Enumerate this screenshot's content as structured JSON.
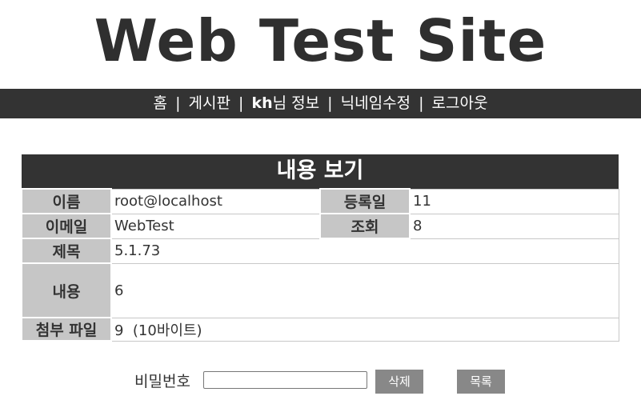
{
  "site": {
    "title": "Web Test Site"
  },
  "nav": {
    "home": "홈",
    "board": "게시판",
    "user_id": "kh",
    "user_info_suffix": "님 정보",
    "nickname_edit": "닉네임수정",
    "logout": "로그아웃",
    "separator": "|"
  },
  "post": {
    "caption": "내용 보기",
    "name_label": "이름",
    "name_value": "root@localhost",
    "date_label": "등록일",
    "date_value": "11",
    "email_label": "이메일",
    "email_value": "WebTest",
    "views_label": "조회",
    "views_value": "8",
    "subject_label": "제목",
    "subject_value": "5.1.73",
    "content_label": "내용",
    "content_value": "6",
    "file_label": "첨부 파일",
    "file_name": "9",
    "file_size": "(10바이트)"
  },
  "actions": {
    "password_label": "비밀번호",
    "password_value": "",
    "delete_label": "삭제",
    "list_label": "목록"
  }
}
